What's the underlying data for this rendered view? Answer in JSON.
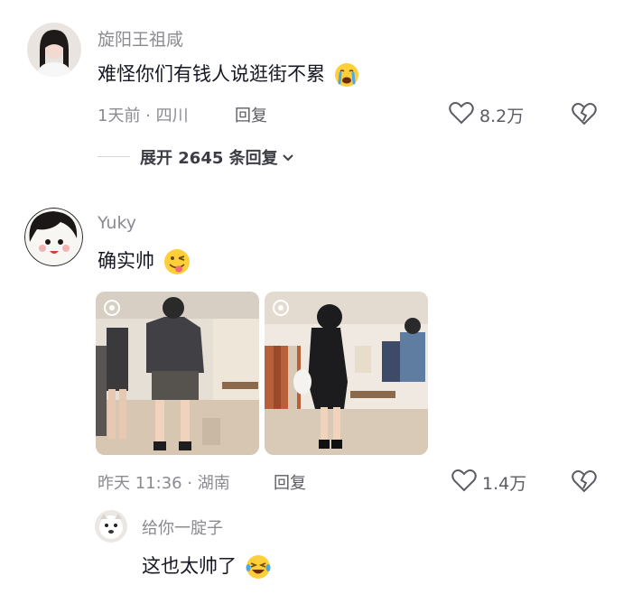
{
  "comments": [
    {
      "username": "旋阳王祖咸",
      "text": "难怪你们有钱人说逛街不累",
      "emoji": "crying-face-icon",
      "meta": "1天前 · 四川",
      "reply_label": "回复",
      "likes": "8.2万",
      "expand_label": "展开 2645 条回复"
    },
    {
      "username": "Yuky",
      "text": "确实帅",
      "emoji": "winking-tongue-face-icon",
      "meta": "昨天 11:36 · 湖南",
      "reply_label": "回复",
      "likes": "1.4万",
      "images": [
        "store-photo-1",
        "store-photo-2"
      ]
    }
  ],
  "reply": {
    "username": "给你一腚子",
    "text": "这也太帅了",
    "emoji": "laughing-tears-face-icon"
  },
  "colors": {
    "secondary_text": "#8a8b91",
    "primary_text": "#161823",
    "background": "#ffffff"
  }
}
